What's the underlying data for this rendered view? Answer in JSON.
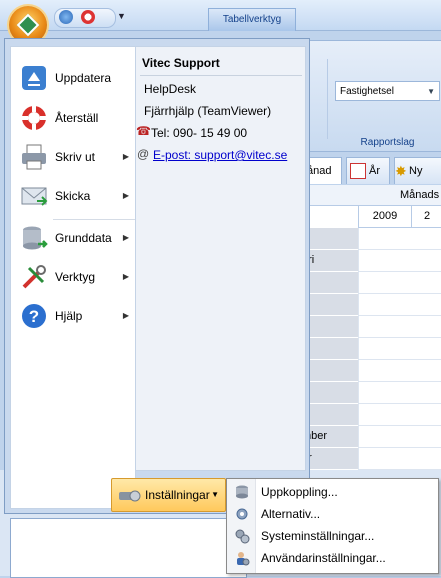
{
  "ribbon": {
    "context_tab": "Tabellverktyg",
    "dropdown_value": "Fastighetsel",
    "group_label": "Rapportslag",
    "view_tabs": [
      "ånad",
      "År",
      "Ny"
    ]
  },
  "grid": {
    "header": "Månads",
    "columns": [
      "2009",
      "2"
    ],
    "rows": [
      "i",
      "ari",
      "",
      "",
      "",
      "",
      "",
      "",
      "ti",
      "mber",
      "er",
      "mber"
    ]
  },
  "app_menu": {
    "items": [
      {
        "label": "Uppdatera",
        "icon": "refresh-icon",
        "submenu": false
      },
      {
        "label": "Återställ",
        "icon": "lifebuoy-icon",
        "submenu": false
      },
      {
        "label": "Skriv ut",
        "icon": "printer-icon",
        "submenu": true
      },
      {
        "label": "Skicka",
        "icon": "envelope-icon",
        "submenu": true
      },
      {
        "label": "Grunddata",
        "icon": "database-icon",
        "submenu": true
      },
      {
        "label": "Verktyg",
        "icon": "tools-icon",
        "submenu": true
      },
      {
        "label": "Hjälp",
        "icon": "help-icon",
        "submenu": true
      }
    ],
    "support": {
      "title": "Vitec Support",
      "helpdesk": "HelpDesk",
      "remote": "Fjärrhjälp (TeamViewer)",
      "tel": "Tel: 090- 15 49 00",
      "email": "E-post: support@vitec.se"
    }
  },
  "settings_button": {
    "label": "Inställningar"
  },
  "settings_menu": {
    "items": [
      {
        "label": "Uppkoppling...",
        "icon": "database-connection-icon"
      },
      {
        "label": "Alternativ...",
        "icon": "options-gear-icon"
      },
      {
        "label": "Systeminställningar...",
        "icon": "system-settings-icon"
      },
      {
        "label": "Användarinställningar...",
        "icon": "user-settings-icon"
      }
    ]
  }
}
